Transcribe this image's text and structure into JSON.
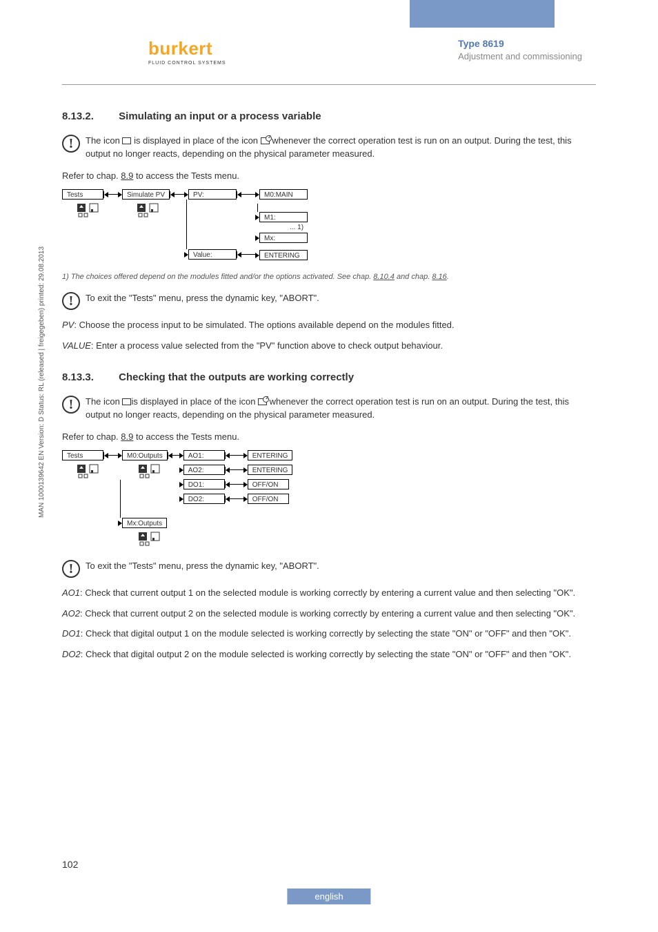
{
  "header": {
    "logo_name": "burkert",
    "logo_sub": "FLUID CONTROL SYSTEMS",
    "type": "Type 8619",
    "section": "Adjustment and commissioning"
  },
  "s1": {
    "num": "8.13.2.",
    "title": "Simulating an input or a process variable",
    "warn": "The icon  is displayed in place of the icon  whenever the correct operation test is run on an output. During the test, this output no longer reacts, depending on the physical parameter measured.",
    "ref": "Refer to chap. ",
    "ref_link": "8.9",
    "ref_tail": " to access the Tests menu.",
    "flow": {
      "tests": "Tests",
      "sim": "Simulate PV",
      "pv": "PV:",
      "m0": "M0:MAIN",
      "m1": "M1:",
      "dots": "...   1)",
      "mx": "Mx:",
      "value": "Value:",
      "entering": "ENTERING"
    },
    "footnote_pre": "1) The choices offered depend on the modules fitted and/or the options activated. See chap. ",
    "footnote_l1": "8.10.4",
    "footnote_mid": " and chap. ",
    "footnote_l2": "8.16",
    "footnote_post": ".",
    "exit": "To exit the \"Tests\" menu, press the dynamic key, \"ABORT\".",
    "pv_line_i": "PV",
    "pv_line": ": Choose the process input to be simulated. The options available depend on the modules fitted.",
    "val_line_i": "VALUE",
    "val_line": ": Enter a process value selected from the \"PV\" function above to check output behaviour."
  },
  "s2": {
    "num": "8.13.3.",
    "title": "Checking that the outputs are working correctly",
    "warn": "The icon  is displayed in place of the icon  whenever the correct operation test is run on an output. During the test, this output no longer reacts, depending on the physical parameter measured.",
    "ref": "Refer to chap. ",
    "ref_link": "8.9",
    "ref_tail": " to access the Tests menu.",
    "flow": {
      "tests": "Tests",
      "m0": "M0:Outputs",
      "mx": "Mx:Outputs",
      "ao1": "AO1:",
      "ao2": "AO2:",
      "do1": "DO1:",
      "do2": "DO2:",
      "entering": "ENTERING",
      "offon": "OFF/ON"
    },
    "exit": "To exit the \"Tests\" menu, press the dynamic key, \"ABORT\".",
    "ao1_i": "AO1",
    "ao1": ": Check that current output 1 on the selected module is working correctly by entering a current value and then selecting \"OK\".",
    "ao2_i": "AO2",
    "ao2": ": Check that current output 2 on the selected module is working correctly by entering a current value and then selecting \"OK\".",
    "do1_i": "DO1",
    "do1": ": Check that digital output 1 on the module selected is working correctly by selecting the state \"ON\" or \"OFF\" and then \"OK\".",
    "do2_i": "DO2",
    "do2": ": Check that digital output 2 on the module selected is working correctly by selecting the state \"ON\" or \"OFF\" and then \"OK\"."
  },
  "sidebar": "MAN 1000139642 EN Version: D Status: RL (released | freigegeben) printed: 29.08.2013",
  "page": "102",
  "lang": "english"
}
